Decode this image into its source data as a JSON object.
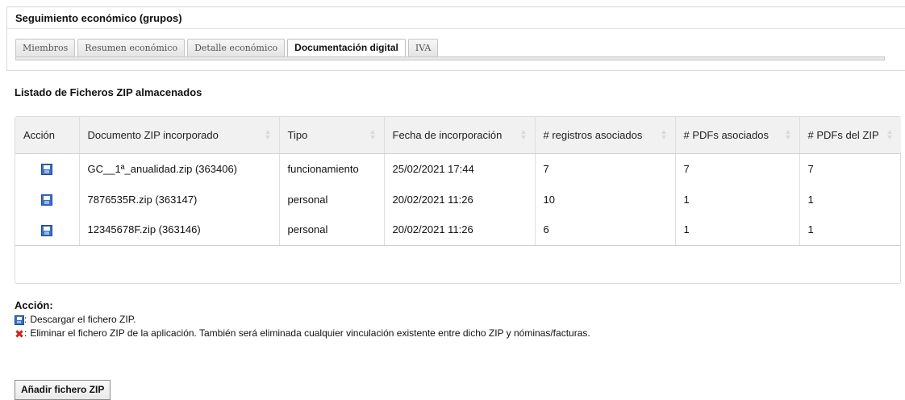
{
  "panel": {
    "title": "Seguimiento económico (grupos)",
    "tabs": [
      {
        "label": "Miembros",
        "active": false
      },
      {
        "label": "Resumen económico",
        "active": false
      },
      {
        "label": "Detalle económico",
        "active": false
      },
      {
        "label": "Documentación digital",
        "active": true
      },
      {
        "label": "IVA",
        "active": false
      }
    ]
  },
  "section_title": "Listado de Ficheros ZIP almacenados",
  "table": {
    "headers": [
      "Acción",
      "Documento ZIP incorporado",
      "Tipo",
      "Fecha de incorporación",
      "# registros asociados",
      "# PDFs asociados",
      "# PDFs del ZIP"
    ],
    "rows": [
      {
        "documento": "GC__1ª_anualidad.zip (363406)",
        "tipo": "funcionamiento",
        "fecha": "25/02/2021 17:44",
        "registros": "7",
        "pdfs_asociados": "7",
        "pdfs_zip": "7"
      },
      {
        "documento": "7876535R.zip (363147)",
        "tipo": "personal",
        "fecha": "20/02/2021 11:26",
        "registros": "10",
        "pdfs_asociados": "1",
        "pdfs_zip": "1"
      },
      {
        "documento": "12345678F.zip (363146)",
        "tipo": "personal",
        "fecha": "20/02/2021 11:26",
        "registros": "6",
        "pdfs_asociados": "1",
        "pdfs_zip": "1"
      }
    ]
  },
  "legend": {
    "title": "Acción:",
    "download_text": "Descargar el fichero ZIP.",
    "delete_text": "Eliminar el fichero ZIP de la aplicación. También será eliminada cualquier vinculación existente entre dicho ZIP y nóminas/facturas.",
    "colon": ":"
  },
  "add_button": "Añadir fichero ZIP",
  "icons": {
    "download": "floppy-disk-icon",
    "delete": "red-x-icon",
    "sort": "sort-icon"
  },
  "colors": {
    "header_bg": "#f1f1f1",
    "disk_blue": "#3b6fc4",
    "delete_red": "#d12020"
  }
}
